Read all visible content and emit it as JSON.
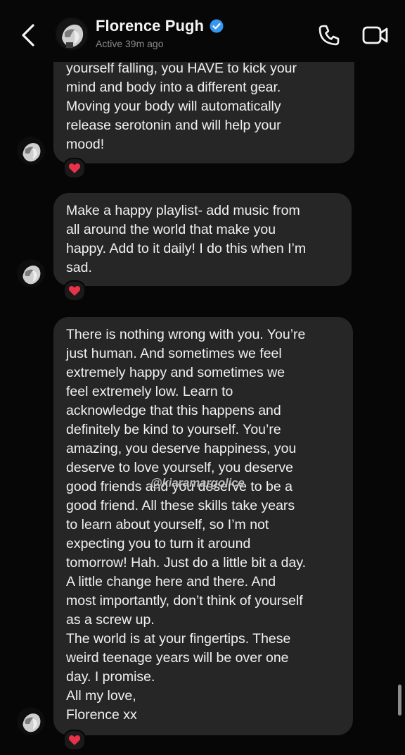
{
  "header": {
    "name": "Florence Pugh",
    "status": "Active 39m ago",
    "icons": {
      "back": "chevron-left-icon",
      "verified": "verified-badge-icon",
      "call": "phone-icon",
      "video": "video-camera-icon"
    }
  },
  "messages": [
    {
      "text": "yourself falling, you HAVE to kick your\nmind and body into a different gear.\nMoving your body will automatically\nrelease serotonin and will help your\nmood!",
      "reaction": "heart"
    },
    {
      "text": "Make a happy playlist- add music from\nall around the world that make you\nhappy. Add to it daily! I do this when I’m\nsad.",
      "reaction": "heart"
    },
    {
      "text": "There is nothing wrong with you. You’re\njust human. And sometimes we feel\nextremely happy and sometimes we\nfeel extremely low. Learn to\nacknowledge that this happens and\ndefinitely be kind to yourself. You’re\namazing, you deserve happiness, you\ndeserve to love yourself, you deserve\ngood friends and you deserve to be a\ngood friend. All these skills take years\nto learn about yourself, so I’m not\nexpecting you to turn it around\ntomorrow! Hah. Just do a little bit a day.\nA little change here and there. And\nmost importantly, don’t think of yourself\nas a screw up.\nThe world is at your fingertips. These\nweird teenage years will be over one\nday. I promise.\nAll my love,\nFlorence xx",
      "reaction": "heart"
    }
  ],
  "watermark": "@kiaramargolice",
  "colors": {
    "background": "#060606",
    "bubble": "#262626",
    "text": "#f1f1f1",
    "status": "#8a8a8a",
    "verified": "#3797f0",
    "heart": "#e8324a"
  }
}
